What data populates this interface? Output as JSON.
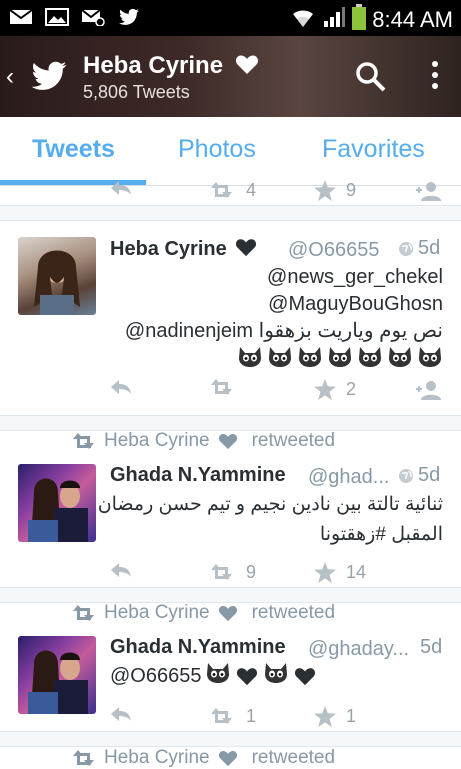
{
  "status_bar": {
    "time": "8:44 AM"
  },
  "header": {
    "name": "Heba Cyrine",
    "tweet_count": "5,806 Tweets"
  },
  "tabs": [
    {
      "label": "Tweets"
    },
    {
      "label": "Photos"
    },
    {
      "label": "Favorites"
    }
  ],
  "partial_top": {
    "retweets": "4",
    "favorites": "9"
  },
  "tweets": [
    {
      "name": "Heba Cyrine",
      "handle": "@O66655",
      "time": "5d",
      "lines": [
        "@news_ger_chekel",
        "@MaguyBouGhosn",
        "@nadinenjeim نص يوم وياريت بزهقوا"
      ],
      "emoji_count": 7,
      "retweets": "",
      "favorites": "2"
    },
    {
      "retweeted_by": "Heba Cyrine",
      "retweeted_label": "retweeted",
      "name": "Ghada N.Yammine",
      "handle": "@ghad...",
      "time": "5d",
      "lines": [
        "ثنائية تالتة بين نادين نجيم و تيم حسن رمضان",
        "المقبل #زهقتونا"
      ],
      "retweets": "9",
      "favorites": "14"
    },
    {
      "retweeted_by": "Heba Cyrine",
      "retweeted_label": "retweeted",
      "name": "Ghada N.Yammine",
      "handle": "@ghaday...",
      "time": "5d",
      "lines": [
        "@O66655"
      ],
      "retweets": "1",
      "favorites": "1"
    }
  ],
  "partial_bottom": {
    "retweeted_by": "Heba Cyrine",
    "retweeted_label": "retweeted"
  },
  "colors": {
    "accent": "#55acee",
    "muted": "#8899a6",
    "text": "#292f33"
  }
}
